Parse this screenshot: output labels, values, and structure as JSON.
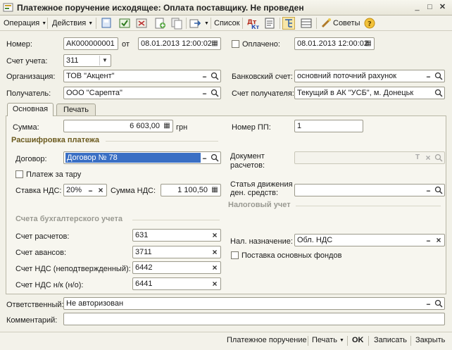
{
  "window": {
    "title": "Платежное поручение исходящее: Оплата поставщику. Не проведен"
  },
  "toolbar": {
    "operation": "Операция",
    "actions": "Действия",
    "list": "Список",
    "tips": "Советы"
  },
  "header": {
    "number_label": "Номер:",
    "number_value": "АК000000001",
    "from_label": "от",
    "date_value": "08.01.2013 12:00:02",
    "paid_label": "Оплачено:",
    "paid_date_value": "08.01.2013 12:00:02",
    "account_label": "Счет учета:",
    "account_value": "311",
    "org_label": "Организация:",
    "org_value": "ТОВ \"Акцент\"",
    "bank_label": "Банковский счет:",
    "bank_value": "основний поточний рахунок",
    "recipient_label": "Получатель:",
    "recipient_value": "ООО \"Сарепта\"",
    "recipient_account_label": "Счет получателя:",
    "recipient_account_value": "Текущий в АК \"УСБ\", м. Донецьк"
  },
  "tabs": [
    "Основная",
    "Печать"
  ],
  "main": {
    "sum_label": "Сумма:",
    "sum_value": "6 603,00",
    "currency": "грн",
    "pp_number_label": "Номер ПП:",
    "pp_number_value": "1",
    "breakdown_title": "Расшифровка платежа",
    "contract_label": "Договор:",
    "contract_value": "Договор № 78",
    "doc_label_1": "Документ",
    "doc_label_2": "расчетов:",
    "doc_value": "",
    "tara_label": "Платеж за тару",
    "vat_rate_label": "Ставка НДС:",
    "vat_rate_value": "20%",
    "vat_sum_label": "Сумма НДС:",
    "vat_sum_value": "1 100,50",
    "cashflow_label_1": "Статья движения",
    "cashflow_label_2": "ден. средств:",
    "cashflow_value": "",
    "tax_title": "Налоговый учет",
    "accounts_title": "Счета бухгалтерского учета",
    "settle_label": "Счет расчетов:",
    "settle_value": "631",
    "advance_label": "Счет авансов:",
    "advance_value": "3711",
    "vat_unconf_label": "Счет НДС (неподтвержденный):",
    "vat_unconf_value": "6442",
    "vat_nk_label": "Счет НДС н/к (н/о):",
    "vat_nk_value": "6441",
    "tax_purpose_label": "Нал. назначение:",
    "tax_purpose_value": "Обл. НДС",
    "fixed_assets_label": "Поставка основных фондов"
  },
  "footer": {
    "responsible_label": "Ответственный:",
    "responsible_value": "Не авторизован",
    "comment_label": "Комментарий:",
    "comment_value": ""
  },
  "bottombar": {
    "payment_order": "Платежное поручение",
    "print": "Печать",
    "ok": "OK",
    "save": "Записать",
    "close": "Закрыть"
  },
  "colors": {
    "accent": "#6b5a1e",
    "selection": "#3a6fc4",
    "background": "#f2f1e8"
  }
}
